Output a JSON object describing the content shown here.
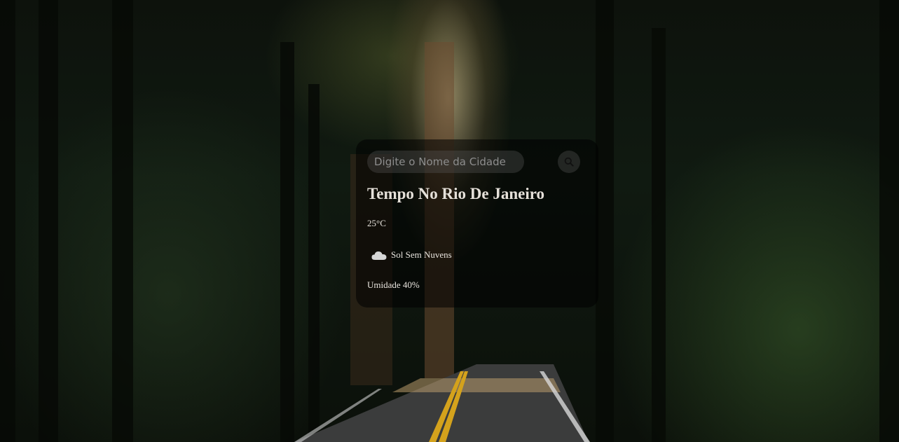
{
  "search": {
    "placeholder": "Digite o Nome da Cidade",
    "value": ""
  },
  "weather": {
    "title": "Tempo No Rio De Janeiro",
    "temperature": "25°C",
    "description": "Sol Sem Nuvens",
    "humidity": "Umidade 40%"
  },
  "icons": {
    "search": "search-icon",
    "weather": "cloud-icon"
  },
  "colors": {
    "card_background": "#000000",
    "text": "#e8e4de",
    "input_background": "#5a5a5a"
  }
}
